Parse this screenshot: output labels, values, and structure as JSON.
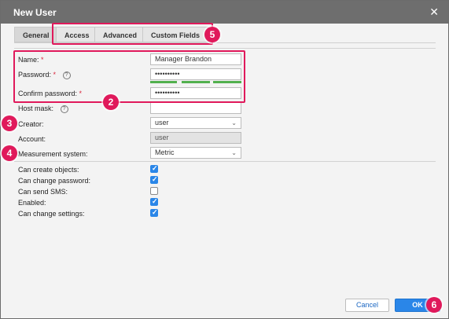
{
  "dialog": {
    "title": "New User",
    "close_glyph": "✕"
  },
  "tabs": [
    {
      "label": "General",
      "active": true
    },
    {
      "label": "Access",
      "active": false
    },
    {
      "label": "Advanced",
      "active": false
    },
    {
      "label": "Custom Fields",
      "active": false
    }
  ],
  "form": {
    "name_label": "Name:",
    "name_value": "Manager Brandon",
    "password_label": "Password:",
    "password_value": "••••••••••",
    "confirm_label": "Confirm password:",
    "confirm_value": "••••••••••",
    "required_mark": "*",
    "help_glyph": "?",
    "hostmask_label": "Host mask:",
    "hostmask_value": "",
    "creator_label": "Creator:",
    "creator_value": "user",
    "account_label": "Account:",
    "account_value": "user",
    "measurement_label": "Measurement system:",
    "measurement_value": "Metric",
    "chevron_glyph": "⌄"
  },
  "options": [
    {
      "label": "Can create objects:",
      "checked": true
    },
    {
      "label": "Can change password:",
      "checked": true
    },
    {
      "label": "Can send SMS:",
      "checked": false
    },
    {
      "label": "Enabled:",
      "checked": true
    },
    {
      "label": "Can change settings:",
      "checked": true
    }
  ],
  "buttons": {
    "cancel": "Cancel",
    "ok": "OK"
  },
  "annotations": {
    "b2": "2",
    "b3": "3",
    "b4": "4",
    "b5": "5",
    "b6": "6"
  },
  "colors": {
    "highlight": "#e0195b",
    "accent": "#2a86e8",
    "strength": "#52b04e"
  }
}
